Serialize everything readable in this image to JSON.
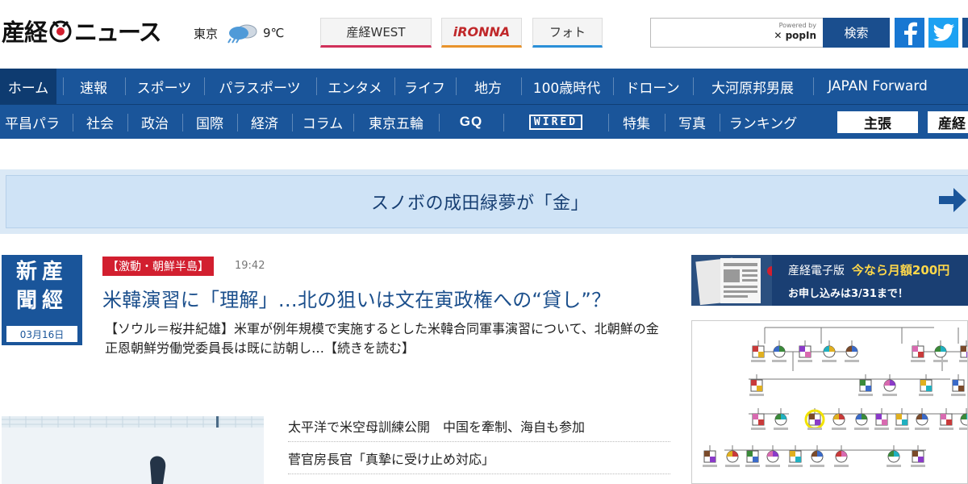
{
  "header": {
    "logo_part1": "産経",
    "logo_part2": "ニュース",
    "weather": {
      "city": "東京",
      "temp": "9℃",
      "icon": "rain-cloud-icon"
    },
    "tabs": [
      {
        "label": "産経WEST",
        "color": "#d0305a"
      },
      {
        "label": "iRONNA",
        "color": "#e8932b"
      },
      {
        "label": "フォト",
        "color": "#2a8fd8"
      }
    ],
    "search": {
      "placeholder": "",
      "powered_by": "Powered by",
      "provider": "popIn",
      "button_label": "検索"
    }
  },
  "nav_primary": [
    "ホーム",
    "速報",
    "スポーツ",
    "パラスポーツ",
    "エンタメ",
    "ライフ",
    "地方",
    "100歳時代",
    "ドローン",
    "大河原邦男展",
    "JAPAN Forward"
  ],
  "nav_secondary": {
    "items_left": [
      "平昌パラ",
      "社会",
      "政治",
      "国際",
      "経済",
      "コラム",
      "東京五輪"
    ],
    "brand_gq": "GQ",
    "brand_wired": "WIRED",
    "items_right": [
      "特集",
      "写真",
      "ランキング"
    ],
    "button_1": "主張",
    "button_2": "産経"
  },
  "banner": {
    "text": "スノボの成田緑夢が「金」"
  },
  "top_article": {
    "paper_logo_chars": [
      "産",
      "經",
      "新",
      "聞"
    ],
    "date": "03月16日",
    "category": "【激動・朝鮮半島】",
    "time": "19:42",
    "title": "米韓演習に「理解」…北の狙いは文在寅政権への“貸し”？",
    "summary": "【ソウル＝桜井紀雄】米軍が例年規模で実施するとした米韓合同軍事演習について、北朝鮮の金正恩朝鮮労働党委員長は既に訪朝し…",
    "more": "【続きを読む】"
  },
  "headlines": [
    "太平洋で米空母訓練公開　中国を牽制、海自も参加",
    "菅官房長官「真摯に受け止め対応」"
  ],
  "ads": {
    "paper_ad": {
      "brand": "産経電子版",
      "promo": "今なら月額200円",
      "cta": "お申し込みは3/31まで！"
    }
  },
  "colors": {
    "nav_bg": "#1a559a",
    "accent_red": "#d21f2f",
    "title_blue": "#1b4f8c"
  }
}
